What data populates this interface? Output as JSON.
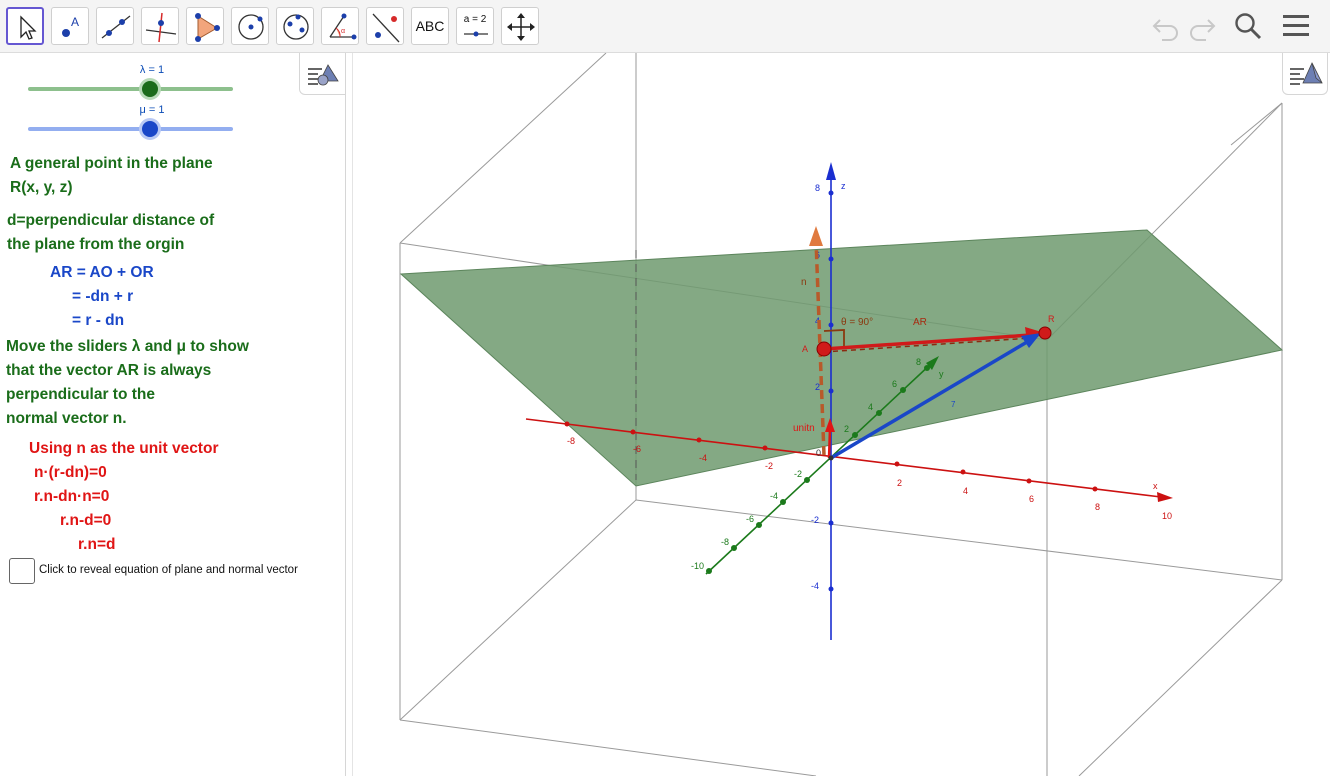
{
  "toolbar": {
    "tools": [
      {
        "name": "move-tool",
        "label": ""
      },
      {
        "name": "point-tool",
        "label": ""
      },
      {
        "name": "line-tool",
        "label": ""
      },
      {
        "name": "perpendicular-line-tool",
        "label": ""
      },
      {
        "name": "polygon-tool",
        "label": ""
      },
      {
        "name": "circle-tool",
        "label": ""
      },
      {
        "name": "conic-tool",
        "label": ""
      },
      {
        "name": "angle-tool",
        "label": ""
      },
      {
        "name": "reflect-tool",
        "label": ""
      },
      {
        "name": "text-tool",
        "label": "ABC"
      },
      {
        "name": "slider-tool",
        "label": "a = 2"
      },
      {
        "name": "move-graphics-tool",
        "label": ""
      }
    ]
  },
  "sliders": {
    "lambda": {
      "label": "λ = 1",
      "value": 1,
      "color": "#1b6b1b",
      "track_color": "#8dc08d"
    },
    "mu": {
      "label": "μ = 1",
      "value": 1,
      "color": "#1a47c8",
      "track_color": "#93aef0"
    }
  },
  "text": {
    "general_point_1": "A general point in the plane",
    "general_point_2": "R(x, y, z)",
    "distance_1": "d=perpendicular distance of",
    "distance_2": "the plane from the orgin",
    "eq_1": "AR = AO + OR",
    "eq_2": "= -dn + r",
    "eq_3": "= r - dn",
    "move_1": "Move the sliders λ and μ to show",
    "move_2": "that the vector AR is always",
    "move_3": "perpendicular to the",
    "move_4": "normal vector n.",
    "unit_1": "Using n as the unit vector",
    "unit_2": "n·(r-dn)=0",
    "unit_3": "r.n-dn·n=0",
    "unit_4": "r.n-d=0",
    "unit_5": "r.n=d"
  },
  "checkbox": {
    "label": "Click to reveal equation of plane and normal vector",
    "checked": false
  },
  "view3d": {
    "x_axis": {
      "name": "x",
      "ticks": [
        "-8",
        "-6",
        "-4",
        "-2",
        "2",
        "4",
        "6",
        "8",
        "10"
      ],
      "color": "#cc1111"
    },
    "y_axis": {
      "name": "y",
      "ticks": [
        "-10",
        "-8",
        "-6",
        "-4",
        "-2",
        "2",
        "4",
        "6",
        "8"
      ],
      "color": "#1b7a1b"
    },
    "z_axis": {
      "name": "z",
      "ticks": [
        "8",
        "6",
        "4",
        "2",
        "-2",
        "-4"
      ],
      "color": "#1a2ed0"
    },
    "point_A": "A",
    "point_R": "R",
    "vector_n": "n",
    "vector_AR": "AR",
    "unit_label": "unitn",
    "angle": "θ = 90°",
    "origin": "0",
    "plane_color": "#6f9a6f"
  },
  "colors": {
    "accent": "#6557d2",
    "green_text": "#1a6d1a",
    "blue_text": "#1a47c8",
    "red_text": "#e01515"
  }
}
